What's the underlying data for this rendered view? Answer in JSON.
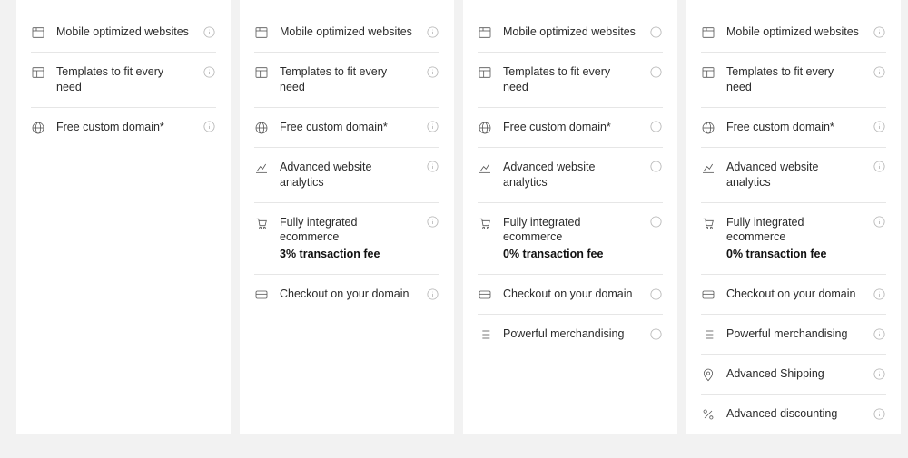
{
  "features": {
    "mobile": "Mobile optimized websites",
    "templates": "Templates to fit every need",
    "domain": "Free custom domain*",
    "analytics": "Advanced website analytics",
    "ecommerce": "Fully integrated ecommerce",
    "fee3": "3% transaction fee",
    "fee0": "0% transaction fee",
    "checkout": "Checkout on your domain",
    "merch": "Powerful merchandising",
    "shipping": "Advanced Shipping",
    "discount": "Advanced discounting"
  },
  "plans": [
    {
      "rows": [
        "mobile",
        "templates",
        "domain"
      ]
    },
    {
      "rows": [
        "mobile",
        "templates",
        "domain",
        "analytics",
        "ecommerce:fee3",
        "checkout"
      ]
    },
    {
      "rows": [
        "mobile",
        "templates",
        "domain",
        "analytics",
        "ecommerce:fee0",
        "checkout",
        "merch"
      ]
    },
    {
      "rows": [
        "mobile",
        "templates",
        "domain",
        "analytics",
        "ecommerce:fee0",
        "checkout",
        "merch",
        "shipping",
        "discount"
      ]
    }
  ],
  "icons": {
    "mobile": "browser-icon",
    "templates": "layout-icon",
    "domain": "globe-icon",
    "analytics": "chart-icon",
    "ecommerce": "cart-icon",
    "checkout": "card-icon",
    "merch": "list-icon",
    "shipping": "pin-icon",
    "discount": "percent-icon"
  }
}
